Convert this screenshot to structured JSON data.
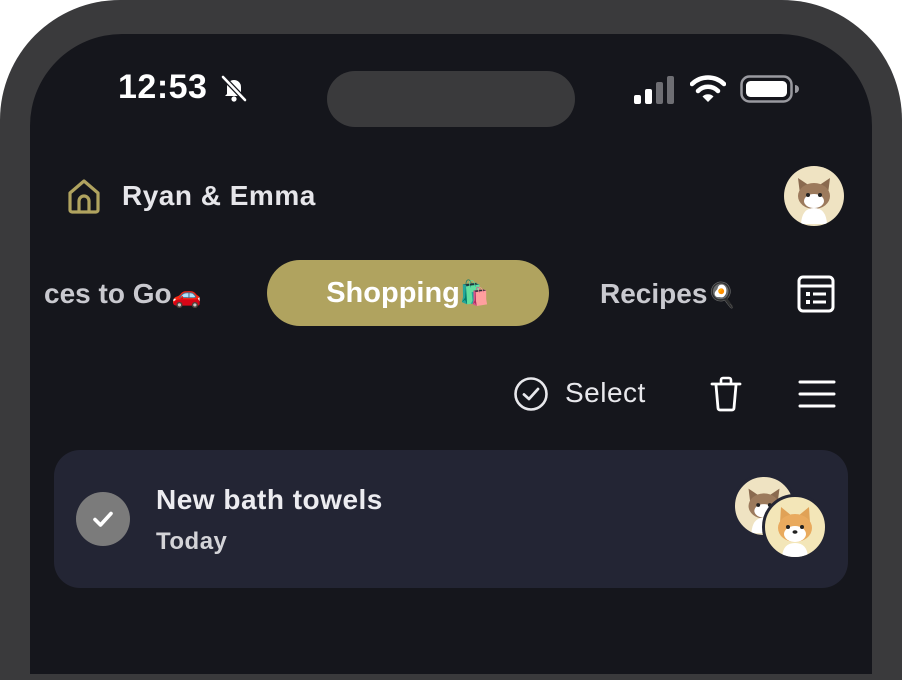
{
  "status_bar": {
    "time": "12:53",
    "icons": [
      "bell-slash-icon",
      "cellular-signal-icon",
      "wifi-icon",
      "battery-icon"
    ]
  },
  "header": {
    "household_name": "Ryan & Emma",
    "home_icon": "home-icon",
    "profile_avatar": "cat-avatar"
  },
  "tabs": {
    "prev_label": "ces to Go",
    "prev_emoji": "🚗",
    "active_label": "Shopping",
    "active_emoji": "🛍️",
    "next_label": "Recipes",
    "next_emoji": "🍳",
    "view_toggle_icon": "list-view-icon"
  },
  "toolbar": {
    "select_label": "Select",
    "select_icon": "check-circle-icon",
    "delete_icon": "trash-icon",
    "menu_icon": "hamburger-menu-icon"
  },
  "items": [
    {
      "title": "New bath towels",
      "date": "Today",
      "completed": true,
      "assignees": [
        "cat-avatar",
        "dog-avatar"
      ]
    }
  ],
  "colors": {
    "background": "#15161c",
    "card": "#232534",
    "accent": "#b0a35f",
    "check": "#7b7b7b"
  }
}
